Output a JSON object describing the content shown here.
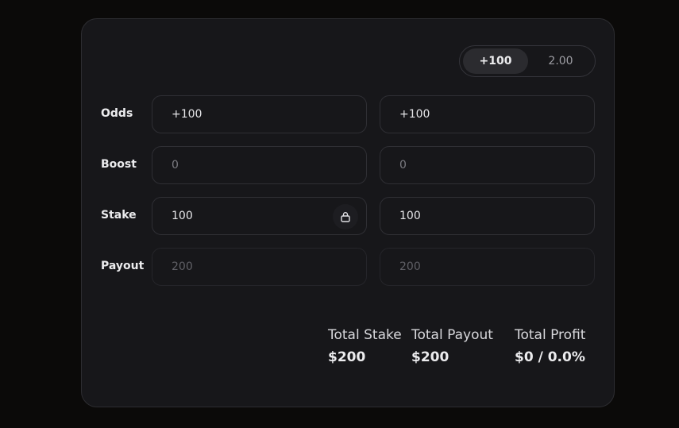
{
  "format_toggle": {
    "options": [
      "+100",
      "2.00"
    ],
    "selected": "+100"
  },
  "rows": {
    "odds": {
      "label": "Odds",
      "values": [
        "+100",
        "+100"
      ]
    },
    "boost": {
      "label": "Boost",
      "values": [
        "0",
        "0"
      ]
    },
    "stake": {
      "label": "Stake",
      "values": [
        "100",
        "100"
      ]
    },
    "payout": {
      "label": "Payout",
      "values": [
        "200",
        "200"
      ]
    }
  },
  "icons": {
    "stake_lock": "lock-icon"
  },
  "summary": {
    "total_stake": {
      "label": "Total Stake",
      "value": "$200"
    },
    "total_payout": {
      "label": "Total Payout",
      "value": "$200"
    },
    "total_profit": {
      "label": "Total Profit",
      "value": "$0 / 0.0%"
    }
  }
}
